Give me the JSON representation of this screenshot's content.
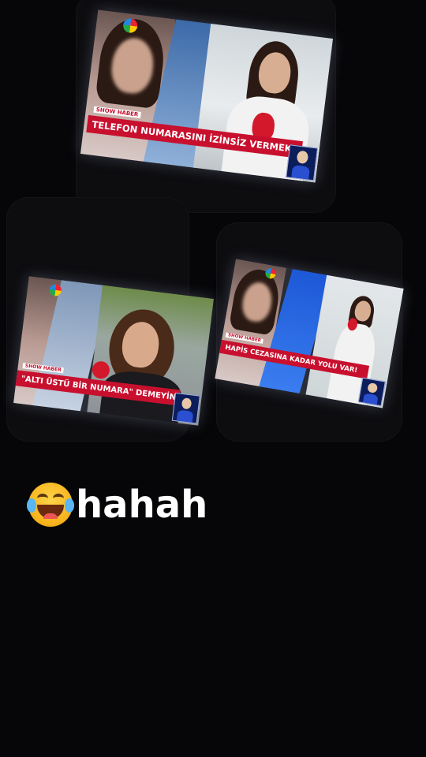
{
  "screens": [
    {
      "tag": "SHOW HABER",
      "headline": "TELEFON NUMARASINI İZİNSİZ VERMEK SUÇ!",
      "mic_label": "SHOW HABER"
    },
    {
      "tag": "SHOW HABER",
      "headline": "\"ALTI ÜSTÜ BİR NUMARA\" DEMEYİN!"
    },
    {
      "tag": "SHOW HABER",
      "headline": "HAPİS CEZASINA KADAR YOLU VAR!"
    }
  ],
  "caption": {
    "emoji": "face-with-tears-of-joy-icon",
    "text": "hahah"
  },
  "colors": {
    "background": "#060608",
    "strap_red": "#c8102e",
    "caption_text": "#ffffff"
  }
}
